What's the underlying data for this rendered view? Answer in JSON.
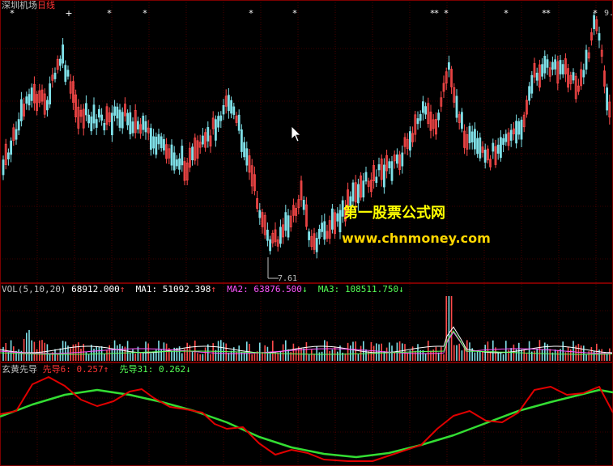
{
  "title": {
    "name": "深圳机场",
    "period": "日线"
  },
  "min_price_label": "7.61",
  "max_price_label": "9.",
  "watermark": {
    "line1": "第一股票公式网",
    "line2": "www.chnmoney.com"
  },
  "vol_panel": {
    "name": "VOL(5,10,20)",
    "value": "68912.000",
    "value_arrow": "↑",
    "ma1_label": "MA1:",
    "ma1_value": "51092.398",
    "ma1_arrow": "↑",
    "ma2_label": "MA2:",
    "ma2_value": "63876.500",
    "ma2_arrow": "↓",
    "ma3_label": "MA3:",
    "ma3_value": "108511.750",
    "ma3_arrow": "↓"
  },
  "indicator_panel": {
    "name": "玄黄先导",
    "line1_label": "先导6:",
    "line1_value": "0.257",
    "line1_arrow": "↑",
    "line2_label": "先导31:",
    "line2_value": "0.262",
    "line2_arrow": "↓"
  },
  "colors": {
    "background": "#000000",
    "grid": "#7a0000",
    "up": "#ff4a4a",
    "down": "#7fe0e8",
    "line1": "#e00000",
    "line2": "#33dd33",
    "title_name": "#c0c0c0",
    "title_period": "#ff3333",
    "watermark1": "#ffff00",
    "watermark2": "#ffd700",
    "ma1": "#ffffff",
    "ma2": "#ff55ff",
    "ma3": "#55ff55"
  },
  "icons": [
    "star-marker-icon",
    "mouse-cursor-icon"
  ]
}
